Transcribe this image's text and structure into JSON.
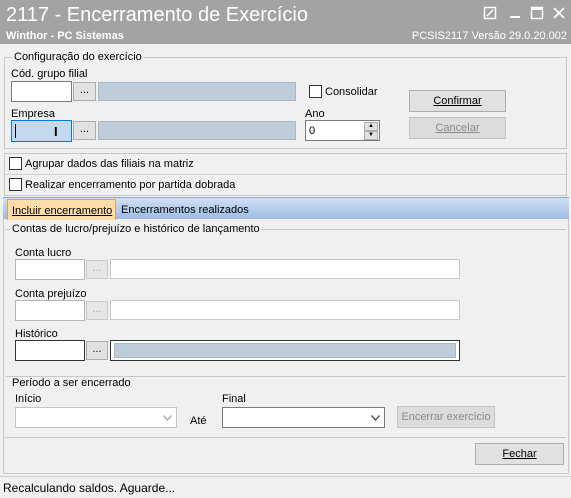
{
  "window": {
    "title": "2117 - Encerramento de Exercício",
    "subtitle": "Winthor - PC Sistemas",
    "version_info": "PCSIS2117  Versão  29.0.20.002"
  },
  "config": {
    "legend": "Configuração do exercício",
    "cod_grupo_filial_label": "Cód. grupo filial",
    "cod_grupo_filial_value": "",
    "consolidar_label": "Consolidar",
    "consolidar_checked": false,
    "empresa_label": "Empresa",
    "empresa_value": "",
    "ano_label": "Ano",
    "ano_value": "0",
    "confirmar_label": "Confirmar",
    "cancelar_label": "Cancelar",
    "lookup_btn": "..."
  },
  "options": {
    "agrupar_label": "Agrupar dados das filiais na matriz",
    "partida_label": "Realizar encerramento por partida dobrada"
  },
  "tabs": [
    {
      "label": "Incluir encerramento",
      "active": true
    },
    {
      "label": "Encerramentos realizados",
      "active": false
    }
  ],
  "contas": {
    "legend": "Contas de lucro/prejuízo e histórico de lançamento",
    "conta_lucro_label": "Conta lucro",
    "conta_prejuizo_label": "Conta prejuízo",
    "historico_label": "Histórico"
  },
  "periodo": {
    "legend": "Período a ser encerrado",
    "inicio_label": "Início",
    "ate_label": "Até",
    "final_label": "Final",
    "encerrar_label": "Encerrar exercício"
  },
  "footer": {
    "fechar_label": "Fechar"
  },
  "status": {
    "text": "Recalculando saldos. Aguarde..."
  },
  "colors": {
    "titlebar": "#a3a3a3",
    "tab_active": "#ffdca8",
    "readonly_field": "#bfcddb"
  }
}
